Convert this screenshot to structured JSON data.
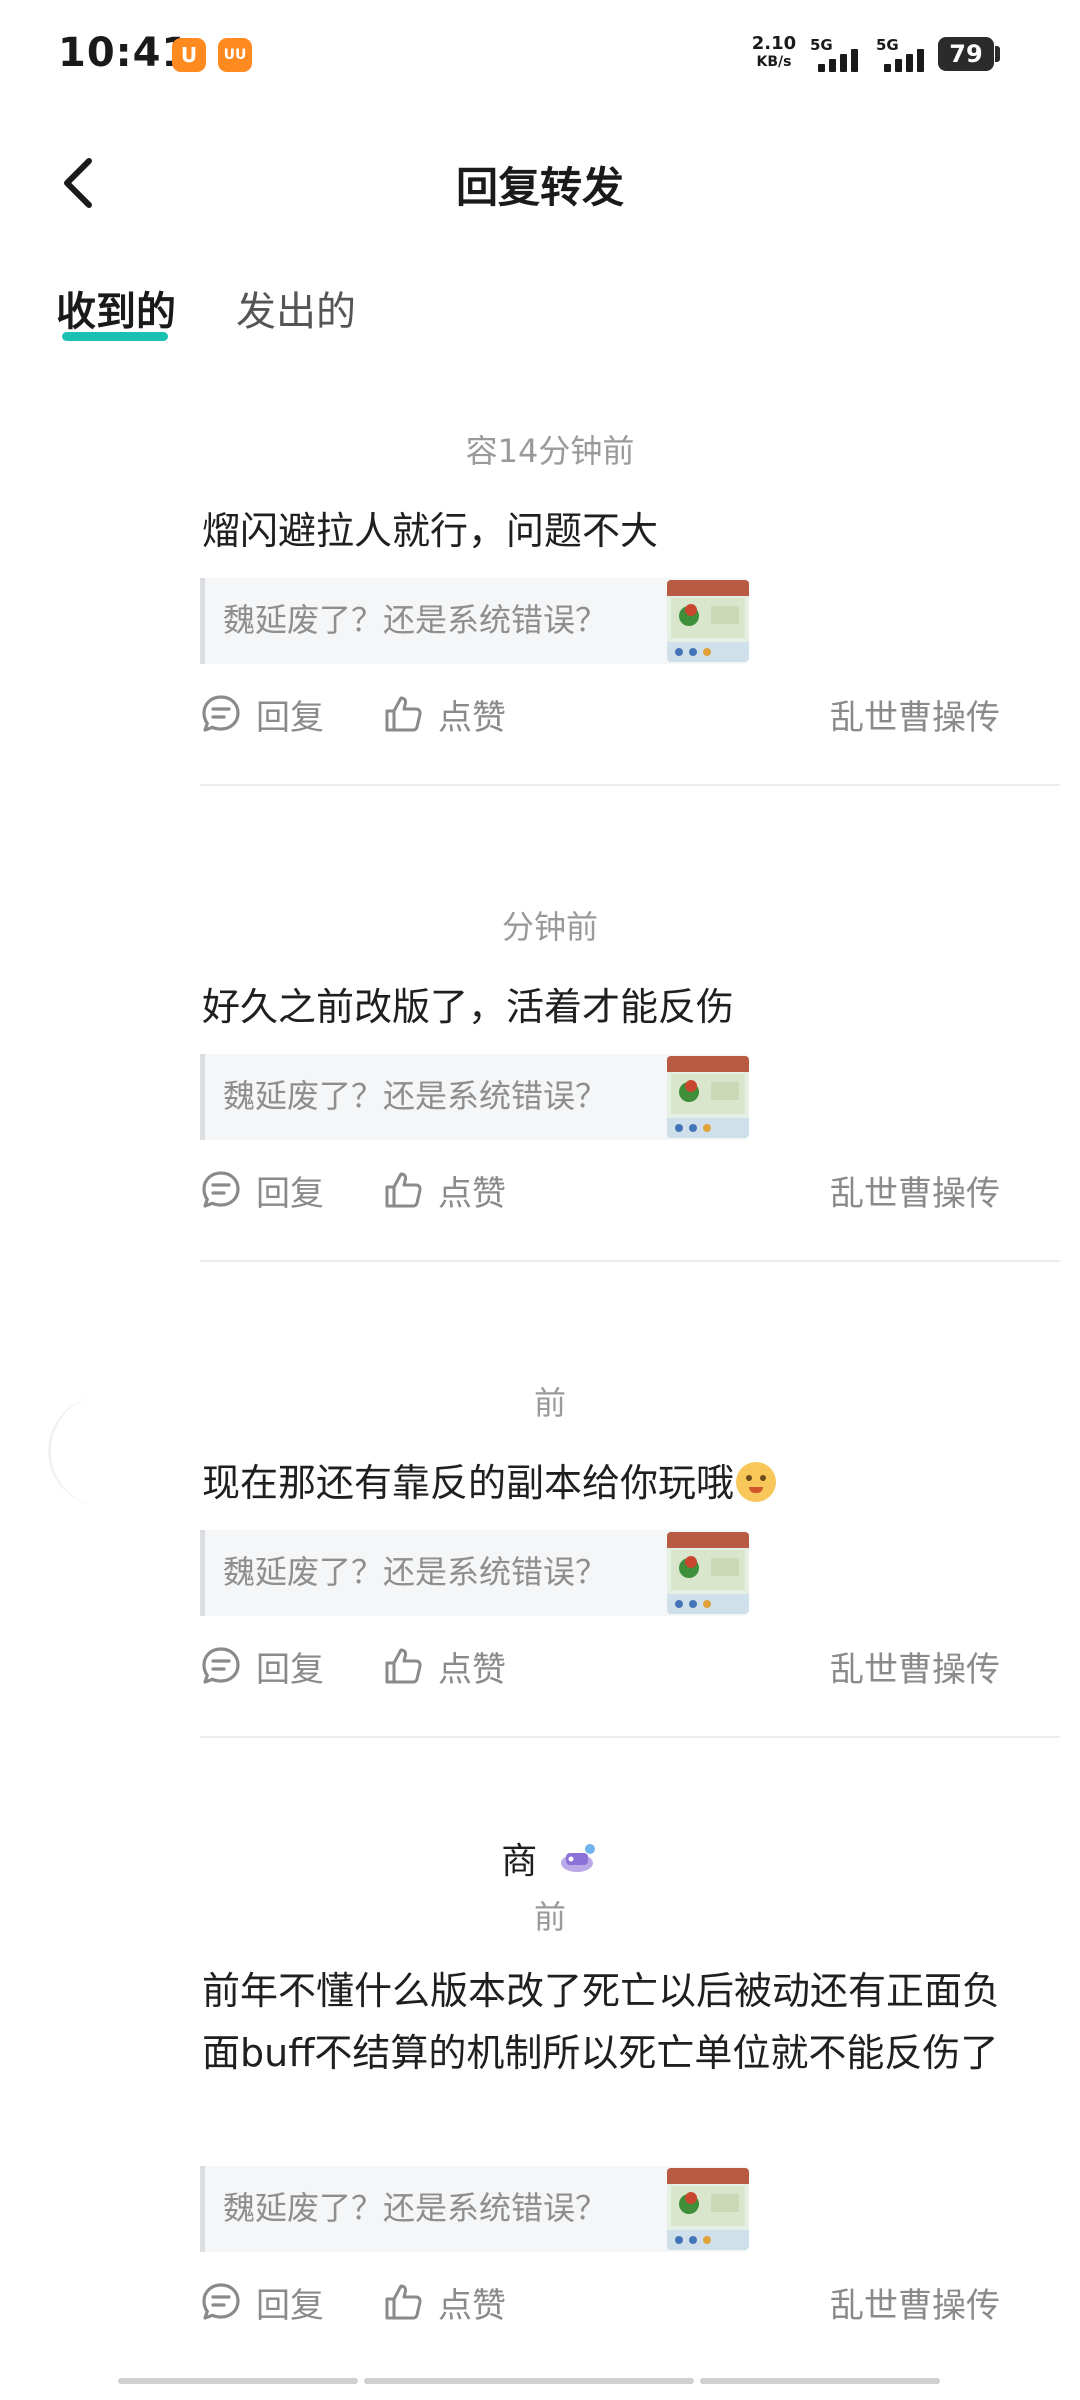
{
  "status_bar": {
    "time": "10:41",
    "app_icon_1": "U",
    "app_icon_2": "UU",
    "net_speed_value": "2.10",
    "net_speed_unit": "KB/s",
    "signal_1_label": "5G",
    "signal_2_label": "5G",
    "battery": "79"
  },
  "header": {
    "title": "回复转发",
    "back_icon": "chevron-left-icon"
  },
  "tabs": [
    {
      "label": "收到的",
      "active": true
    },
    {
      "label": "发出的",
      "active": false
    }
  ],
  "actions": {
    "reply_label": "回复",
    "like_label": "点赞"
  },
  "colors": {
    "accent": "#1ac0b2",
    "meta_text": "#9a9a9a",
    "quote_bg": "#f5f6f7"
  },
  "replies": [
    {
      "meta": "容14分钟前",
      "comment": "熘闪避拉人就行，问题不大",
      "quote": "魏延废了？还是系统错误？",
      "game": "乱世曹操传"
    },
    {
      "meta": "分钟前",
      "comment": "好久之前改版了，活着才能反伤",
      "quote": "魏延废了？还是系统错误？",
      "game": "乱世曹操传"
    },
    {
      "meta": "前",
      "comment": "现在那还有靠反的副本给你玩哦",
      "quote": "魏延废了？还是系统错误？",
      "game": "乱世曹操传"
    },
    {
      "meta_name": "商",
      "meta": "前",
      "comment": "前年不懂什么版本改了死亡以后被动还有正面负面buff不结算的机制所以死亡单位就不能反伤了",
      "quote": "魏延废了？还是系统错误？",
      "game": "乱世曹操传"
    }
  ]
}
